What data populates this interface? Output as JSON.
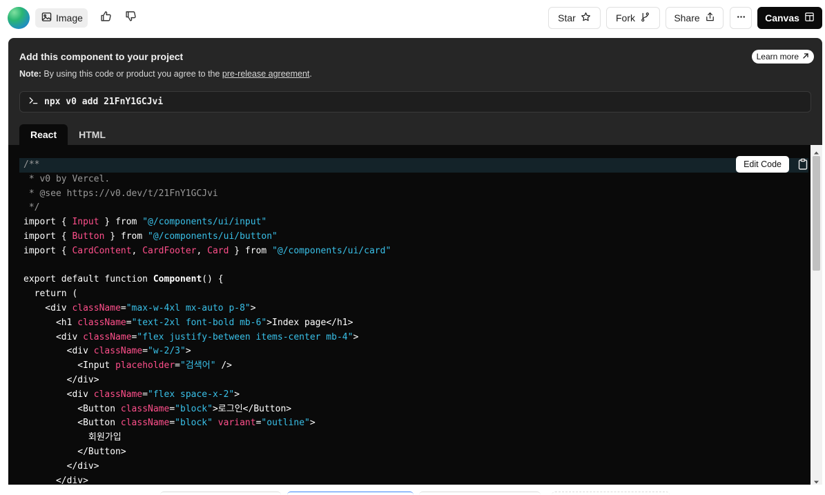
{
  "toolbar": {
    "image_label": "Image",
    "star_label": "Star",
    "fork_label": "Fork",
    "share_label": "Share",
    "canvas_label": "Canvas",
    "more_icon": "ellipsis-icon"
  },
  "panel": {
    "title": "Add this component to your project",
    "learn_more": "Learn more",
    "note_prefix": "Note:",
    "note_text": " By using this code or product you agree to the ",
    "note_link": "pre-release agreement",
    "note_suffix": ".",
    "command": "npx v0 add 21FnY1GCJvi",
    "tabs": [
      "React",
      "HTML"
    ],
    "active_tab": "React"
  },
  "code": {
    "edit_label": "Edit Code",
    "lines": [
      [
        [
          "c",
          "/**"
        ]
      ],
      [
        [
          "c",
          " * v0 by Vercel."
        ]
      ],
      [
        [
          "c",
          " * @see https://v0.dev/t/21FnY1GCJvi"
        ]
      ],
      [
        [
          "c",
          " */"
        ]
      ],
      [
        [
          "k",
          "import { "
        ],
        [
          "i",
          "Input"
        ],
        [
          "k",
          " } from "
        ],
        [
          "s",
          "\"@/components/ui/input\""
        ]
      ],
      [
        [
          "k",
          "import { "
        ],
        [
          "i",
          "Button"
        ],
        [
          "k",
          " } from "
        ],
        [
          "s",
          "\"@/components/ui/button\""
        ]
      ],
      [
        [
          "k",
          "import { "
        ],
        [
          "i",
          "CardContent"
        ],
        [
          "k",
          ", "
        ],
        [
          "i",
          "CardFooter"
        ],
        [
          "k",
          ", "
        ],
        [
          "i",
          "Card"
        ],
        [
          "k",
          " } from "
        ],
        [
          "s",
          "\"@/components/ui/card\""
        ]
      ],
      [
        [
          "p",
          ""
        ]
      ],
      [
        [
          "k",
          "export default function "
        ],
        [
          "b",
          "Component"
        ],
        [
          "k",
          "() {"
        ]
      ],
      [
        [
          "k",
          "  return ("
        ]
      ],
      [
        [
          "p",
          "    <div "
        ],
        [
          "a",
          "className"
        ],
        [
          "p",
          "="
        ],
        [
          "s",
          "\"max-w-4xl mx-auto p-8\""
        ],
        [
          "p",
          ">"
        ]
      ],
      [
        [
          "p",
          "      <h1 "
        ],
        [
          "a",
          "className"
        ],
        [
          "p",
          "="
        ],
        [
          "s",
          "\"text-2xl font-bold mb-6\""
        ],
        [
          "p",
          ">Index page</h1>"
        ]
      ],
      [
        [
          "p",
          "      <div "
        ],
        [
          "a",
          "className"
        ],
        [
          "p",
          "="
        ],
        [
          "s",
          "\"flex justify-between items-center mb-4\""
        ],
        [
          "p",
          ">"
        ]
      ],
      [
        [
          "p",
          "        <div "
        ],
        [
          "a",
          "className"
        ],
        [
          "p",
          "="
        ],
        [
          "s",
          "\"w-2/3\""
        ],
        [
          "p",
          ">"
        ]
      ],
      [
        [
          "p",
          "          <Input "
        ],
        [
          "a",
          "placeholder"
        ],
        [
          "p",
          "="
        ],
        [
          "s",
          "\"검색어\""
        ],
        [
          "p",
          " />"
        ]
      ],
      [
        [
          "p",
          "        </div>"
        ]
      ],
      [
        [
          "p",
          "        <div "
        ],
        [
          "a",
          "className"
        ],
        [
          "p",
          "="
        ],
        [
          "s",
          "\"flex space-x-2\""
        ],
        [
          "p",
          ">"
        ]
      ],
      [
        [
          "p",
          "          <Button "
        ],
        [
          "a",
          "className"
        ],
        [
          "p",
          "="
        ],
        [
          "s",
          "\"block\""
        ],
        [
          "p",
          ">로그인</Button>"
        ]
      ],
      [
        [
          "p",
          "          <Button "
        ],
        [
          "a",
          "className"
        ],
        [
          "p",
          "="
        ],
        [
          "s",
          "\"block\""
        ],
        [
          "p",
          " "
        ],
        [
          "a",
          "variant"
        ],
        [
          "p",
          "="
        ],
        [
          "s",
          "\"outline\""
        ],
        [
          "p",
          ">"
        ]
      ],
      [
        [
          "p",
          "            회원가입"
        ]
      ],
      [
        [
          "p",
          "          </Button>"
        ]
      ],
      [
        [
          "p",
          "        </div>"
        ]
      ],
      [
        [
          "p",
          "      </div>"
        ]
      ]
    ]
  }
}
